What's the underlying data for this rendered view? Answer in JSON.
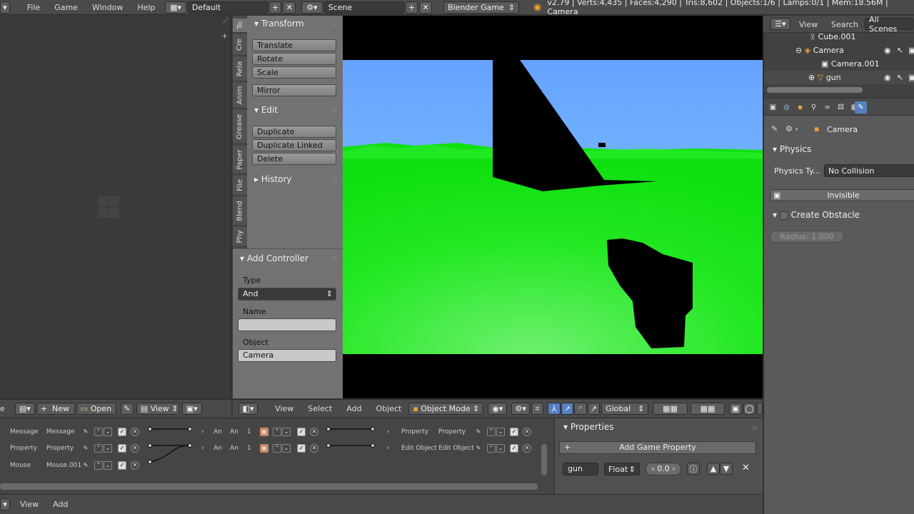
{
  "topbar": {
    "menus": [
      "File",
      "Game",
      "Window",
      "Help"
    ],
    "screen_layout": "Default",
    "scene": "Scene",
    "engine": "Blender Game",
    "stats": "v2.79 | Verts:4,435 | Faces:4,290 | Tris:8,602 | Objects:1/6 | Lamps:0/1 | Mem:18.56M | Camera"
  },
  "toolshelf": {
    "tabs": [
      "To",
      "Cre",
      "Rela",
      "Anim",
      "Grease",
      "Paper",
      "File",
      "Blend",
      "Phy"
    ],
    "transform_header": "Transform",
    "translate": "Translate",
    "rotate": "Rotate",
    "scale": "Scale",
    "mirror": "Mirror",
    "edit_header": "Edit",
    "duplicate": "Duplicate",
    "duplicate_linked": "Duplicate Linked",
    "delete": "Delete",
    "history_header": "History"
  },
  "add_controller": {
    "header": "Add Controller",
    "type_label": "Type",
    "type_value": "And",
    "name_label": "Name",
    "name_value": "",
    "object_label": "Object",
    "object_value": "Camera"
  },
  "outliner": {
    "view": "View",
    "search": "Search",
    "scenes": "All Scenes",
    "items": [
      "Cube.001",
      "Camera",
      "Camera.001",
      "gun"
    ]
  },
  "properties": {
    "breadcrumb": "Camera",
    "physics_header": "Physics",
    "physics_type_label": "Physics Ty...",
    "physics_type_value": "No Collision",
    "invisible": "Invisible",
    "create_obstacle": "Create Obstacle",
    "radius": "Radius:  1.000"
  },
  "viewport_header": {
    "view": "View",
    "select": "Select",
    "add": "Add",
    "object": "Object",
    "mode": "Object Mode",
    "orientation": "Global"
  },
  "logic_header": {
    "edge_text": "e",
    "new": "New",
    "open": "Open",
    "view": "View"
  },
  "logic": {
    "sensors": [
      {
        "type": "Message",
        "name": "Message"
      },
      {
        "type": "Property",
        "name": "Property"
      },
      {
        "type": "Mouse",
        "name": "Mouse.001"
      }
    ],
    "controllers": [
      {
        "type": "An",
        "name": "An",
        "num": "1"
      },
      {
        "type": "An",
        "name": "An",
        "num": "1"
      }
    ],
    "actuators": [
      {
        "type": "Property",
        "name": "Property"
      },
      {
        "type": "Edit Object",
        "name": "Edit Object"
      }
    ]
  },
  "game_props": {
    "header": "Properties",
    "add_button": "Add Game Property",
    "prop_name": "gun",
    "prop_type": "Float",
    "prop_value": "0.0"
  },
  "footer": {
    "view": "View",
    "add": "Add"
  },
  "colors": {
    "sky": "#66a3ff",
    "ground": "#00ee00",
    "selected_tab": "#5680c2"
  }
}
